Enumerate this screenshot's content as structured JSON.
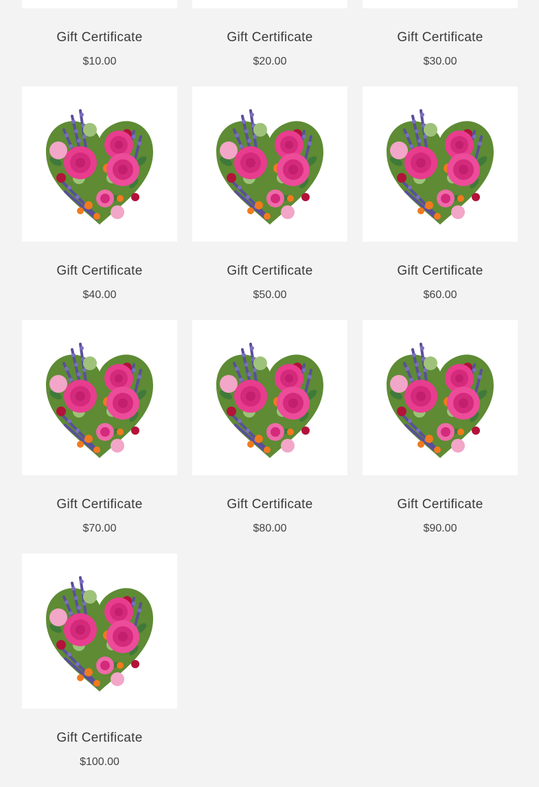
{
  "products": [
    {
      "name": "Gift Certificate",
      "price": "$10.00"
    },
    {
      "name": "Gift Certificate",
      "price": "$20.00"
    },
    {
      "name": "Gift Certificate",
      "price": "$30.00"
    },
    {
      "name": "Gift Certificate",
      "price": "$40.00"
    },
    {
      "name": "Gift Certificate",
      "price": "$50.00"
    },
    {
      "name": "Gift Certificate",
      "price": "$60.00"
    },
    {
      "name": "Gift Certificate",
      "price": "$70.00"
    },
    {
      "name": "Gift Certificate",
      "price": "$80.00"
    },
    {
      "name": "Gift Certificate",
      "price": "$90.00"
    },
    {
      "name": "Gift Certificate",
      "price": "$100.00"
    }
  ],
  "colors": {
    "background": "#f3f3f3",
    "card": "#ffffff",
    "rose": "#e83d8f",
    "rose_dark": "#c21f6e",
    "lavender": "#5a4f9a",
    "orange": "#f07a1e",
    "leaf": "#6a9a3a"
  },
  "image_icon": "flower-heart-bouquet-icon"
}
